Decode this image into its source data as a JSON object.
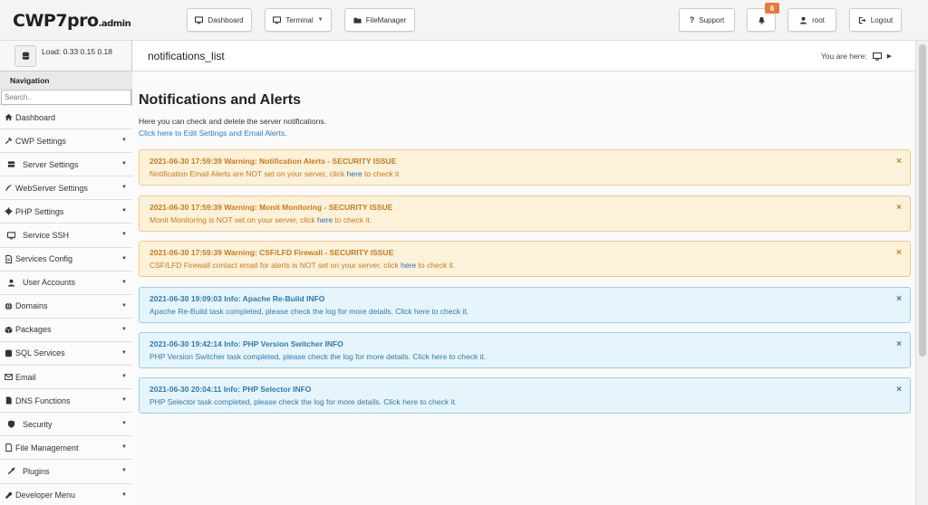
{
  "logo": {
    "main": "CWP7pro",
    "sub": ".admin"
  },
  "topbar": {
    "dashboard": "Dashboard",
    "terminal": "Terminal",
    "filemanager": "FileManager",
    "support": "Support",
    "notifications_count": "6",
    "user": "root",
    "logout": "Logout"
  },
  "sidebar": {
    "load_label": "Load: 0.33  0.15  0.18",
    "nav_title": "Navigation",
    "search_placeholder": "Search..",
    "items": [
      {
        "label": "Dashboard",
        "icon": "home-icon"
      },
      {
        "label": "CWP Settings",
        "icon": "tools-icon"
      },
      {
        "label": "Server Settings",
        "icon": "server-icon"
      },
      {
        "label": "WebServer Settings",
        "icon": "feather-icon"
      },
      {
        "label": "PHP Settings",
        "icon": "gear-icon"
      },
      {
        "label": "Service SSH",
        "icon": "monitor-icon"
      },
      {
        "label": "Services Config",
        "icon": "document-icon"
      },
      {
        "label": "User Accounts",
        "icon": "user-icon"
      },
      {
        "label": "Domains",
        "icon": "globe-icon"
      },
      {
        "label": "Packages",
        "icon": "box-icon"
      },
      {
        "label": "SQL Services",
        "icon": "database-icon"
      },
      {
        "label": "Email",
        "icon": "envelope-icon"
      },
      {
        "label": "DNS Functions",
        "icon": "dns-icon"
      },
      {
        "label": "Security",
        "icon": "shield-icon"
      },
      {
        "label": "File Management",
        "icon": "file-icon"
      },
      {
        "label": "Plugins",
        "icon": "plug-icon"
      },
      {
        "label": "Developer Menu",
        "icon": "wrench-icon"
      }
    ]
  },
  "page": {
    "title": "notifications_list",
    "you_are_here": "You are here:",
    "heading": "Notifications and Alerts",
    "description": "Here you can check and delete the server notifications.",
    "settings_link": "Click here to Edit Settings and Email Alerts",
    "settings_link_tail": "."
  },
  "alerts": [
    {
      "type": "warning",
      "title": "2021-06-30 17:59:39 Warning: Notification Alerts - SECURITY ISSUE",
      "message": "Notification Email Alerts are NOT set on your server, click ",
      "link": "here",
      "tail": " to check it."
    },
    {
      "type": "warning",
      "title": "2021-06-30 17:59:39 Warning: Monit Monitoring - SECURITY ISSUE",
      "message": "Monit Monitoring is NOT set on your server, click ",
      "link": "here",
      "tail": " to check it."
    },
    {
      "type": "warning",
      "title": "2021-06-30 17:59:39 Warning: CSF/LFD Firewall - SECURITY ISSUE",
      "message": "CSF/LFD Firewall contact email for alerts is NOT set on your server, click ",
      "link": "here",
      "tail": " to check it."
    },
    {
      "type": "info",
      "title": "2021-06-30 19:09:03 Info: Apache Re-Build INFO",
      "message": "Apache Re-Build task completed, please check the log for more details. Click ",
      "link": "here",
      "tail": " to check it."
    },
    {
      "type": "info",
      "title": "2021-06-30 19:42:14 Info: PHP Version Switcher INFO",
      "message": "PHP Version Switcher task completed, please check the log for more details. Click ",
      "link": "here",
      "tail": " to check it."
    },
    {
      "type": "info",
      "title": "2021-06-30 20:04:11 Info: PHP Selector INFO",
      "message": "PHP Selector task completed, please check the log for more details. Click ",
      "link": "here",
      "tail": " to check it."
    }
  ],
  "close_glyph": "×",
  "colors": {
    "warning": "#c87a1c",
    "info": "#2e7bad",
    "badge": "#e8793c",
    "link": "#2a7fc0"
  }
}
